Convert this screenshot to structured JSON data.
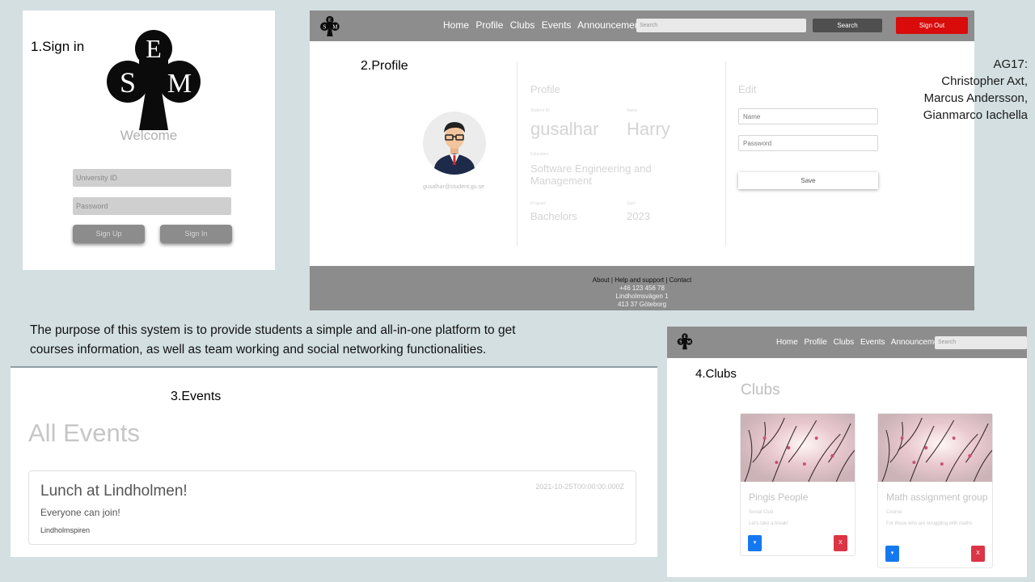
{
  "panel1": {
    "label": "1.Sign  in",
    "logo_letters": [
      "E",
      "S",
      "M"
    ],
    "welcome": "Welcome",
    "university_id_placeholder": "University ID",
    "password_placeholder": "Password",
    "signup_label": "Sign Up",
    "signin_label": "Sign In"
  },
  "panel2": {
    "label": "2.Profile",
    "nav": {
      "items": [
        "Home",
        "Profile",
        "Clubs",
        "Events",
        "Announcements"
      ],
      "search_placeholder": "Search",
      "search_label": "Search",
      "signout_label": "Sign Out"
    },
    "email": "gusalhar@student.gu.se",
    "profile": {
      "heading": "Profile",
      "student_id_label": "Student ID",
      "student_id": "gusalhar",
      "name_label": "Name",
      "name": "Harry",
      "education_label": "Education",
      "education_line1": "Software Engineering and",
      "education_line2": "Management",
      "program_label": "Program",
      "program": "Bachelors",
      "start_label": "Start",
      "start": "2023"
    },
    "edit": {
      "heading": "Edit",
      "name_placeholder": "Name",
      "password_placeholder": "Password",
      "save_label": "Save"
    },
    "footer": {
      "about": "About",
      "help": "Help and support",
      "contact": "Contact",
      "phone": "+46 123 456 78",
      "street": "Lindholmsvägen 1",
      "city": "413 37 Göteborg"
    }
  },
  "credits": {
    "group": "AG17:",
    "members": [
      "Christopher Axt,",
      "Marcus Andersson,",
      "Gianmarco Iachella"
    ]
  },
  "purpose": {
    "line1": "The purpose of this system is to provide students a simple and all-in-one platform to get",
    "line2": "courses information, as well as team working and social networking functionalities."
  },
  "panel3": {
    "label": "3.Events",
    "title": "All Events",
    "event": {
      "title": "Lunch at Lindholmen!",
      "description": "Everyone can join!",
      "location": "Lindholmspiren",
      "date": "2021-10-25T00:00:00.000Z"
    }
  },
  "panel4": {
    "label": "4.Clubs",
    "nav": {
      "items": [
        "Home",
        "Profile",
        "Clubs",
        "Events",
        "Announcements"
      ],
      "search_placeholder": "Search"
    },
    "title": "Clubs",
    "clubs": [
      {
        "name": "Pingis People",
        "type": "Social Club",
        "description": "Let's take a break!",
        "view_label": "▾",
        "delete_label": "X"
      },
      {
        "name": "Math assignment group",
        "type": "Course",
        "description": "For those who are struggling with maths",
        "view_label": "▾",
        "delete_label": "X"
      }
    ]
  },
  "colors": {
    "nav_gray": "#8d8d8d",
    "signout_red": "#d90b0b",
    "button_blue": "#1478f0",
    "button_red": "#dc3545",
    "background": "#d3dfe1"
  }
}
